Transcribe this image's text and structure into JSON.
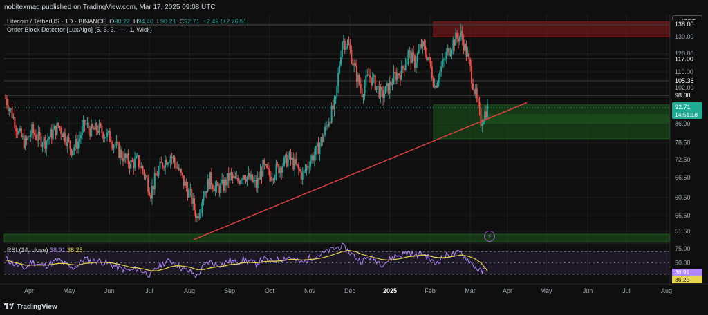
{
  "header": {
    "published": "nobitexmag published on TradingView.com, Mar 17, 2025 09:08 UTC",
    "symbol": "Litecoin / TetherUS · 1D · BINANCE",
    "ohlc": {
      "o_label": "O",
      "o": "90.22",
      "h_label": "H",
      "h": "94.40",
      "l_label": "L",
      "l": "90.21",
      "c_label": "C",
      "c": "92.71",
      "change": "+2.49 (+2.76%)"
    },
    "indicator": "Order Block Detector [LuxAlgo] (5, 3, 3, ──, 1, Wick)",
    "currency": "USDT"
  },
  "chart_data": {
    "type": "candlestick",
    "title": "Litecoin / TetherUS · 1D · BINANCE",
    "x_ticks": [
      "Apr",
      "May",
      "Jun",
      "Jul",
      "Aug",
      "Sep",
      "Oct",
      "Nov",
      "Dec",
      "2025",
      "Feb",
      "Mar",
      "Apr",
      "May",
      "Jun",
      "Jul",
      "Aug"
    ],
    "y_ticks": [
      "138.00",
      "130.00",
      "120.00",
      "117.00",
      "110.00",
      "105.38",
      "102.00",
      "98.30",
      "86.00",
      "78.50",
      "72.50",
      "66.50",
      "60.50",
      "55.50",
      "51.50"
    ],
    "price_axis_scale": "log",
    "last_price": "92.71",
    "countdown": "14:51:18",
    "ylim": [
      49,
      145
    ],
    "closes_weekly": [
      97,
      90,
      82,
      78,
      83,
      80,
      79,
      82,
      85,
      81,
      76,
      79,
      86,
      83,
      84,
      82,
      80,
      76,
      73,
      71,
      72,
      68,
      62,
      68,
      72,
      74,
      70,
      65,
      61,
      55,
      62,
      66,
      63,
      64,
      67,
      65,
      68,
      66,
      64,
      70,
      67,
      69,
      71,
      73,
      70,
      67,
      72,
      75,
      80,
      88,
      95,
      128,
      124,
      110,
      100,
      108,
      104,
      98,
      102,
      108,
      110,
      120,
      115,
      125,
      118,
      103,
      112,
      121,
      128,
      131,
      118,
      101,
      87,
      92.71
    ],
    "horizontal_levels": [
      117.0,
      105.38,
      98.3,
      137.5
    ],
    "order_blocks": [
      {
        "type": "bearish",
        "from": "Feb",
        "top": 139.5,
        "bottom": 130.0,
        "color": "#8a1a1a"
      },
      {
        "type": "bullish",
        "from": "Feb",
        "top": 94.0,
        "bottom": 80.0,
        "color": "#1e5a1e"
      },
      {
        "type": "bullish",
        "from": "Apr",
        "top": 50.8,
        "bottom": 49.0,
        "color": "#1e5a1e"
      }
    ],
    "trendline": {
      "from_date": "Aug",
      "from_price": 49.5,
      "to_date": "Mar",
      "to_price": 95.0,
      "color": "#e04040"
    },
    "rsi": {
      "label": "RSI (14, close)",
      "value": "38.91",
      "ma_value": "36.25",
      "levels": [
        "75.00",
        "50.00"
      ],
      "band": [
        70,
        30
      ],
      "ylim": [
        20,
        85
      ],
      "values_weekly": [
        58,
        50,
        44,
        40,
        52,
        47,
        45,
        50,
        55,
        48,
        40,
        46,
        58,
        52,
        54,
        50,
        47,
        41,
        38,
        36,
        40,
        34,
        28,
        42,
        50,
        54,
        46,
        38,
        34,
        26,
        44,
        52,
        46,
        48,
        54,
        50,
        56,
        52,
        48,
        58,
        52,
        55,
        58,
        60,
        54,
        50,
        58,
        62,
        66,
        72,
        76,
        80,
        70,
        60,
        52,
        60,
        56,
        48,
        54,
        62,
        64,
        70,
        62,
        68,
        60,
        48,
        58,
        64,
        66,
        68,
        56,
        44,
        34,
        38.91
      ],
      "ma_weekly": [
        55,
        52,
        49,
        46,
        46,
        46,
        46,
        47,
        49,
        49,
        47,
        46,
        49,
        50,
        51,
        51,
        50,
        48,
        45,
        42,
        41,
        39,
        36,
        36,
        39,
        43,
        45,
        44,
        42,
        38,
        38,
        41,
        43,
        44,
        47,
        48,
        50,
        51,
        50,
        52,
        53,
        53,
        54,
        56,
        56,
        55,
        56,
        57,
        59,
        62,
        66,
        70,
        72,
        70,
        65,
        62,
        59,
        56,
        55,
        56,
        58,
        61,
        62,
        64,
        63,
        60,
        59,
        60,
        62,
        64,
        62,
        58,
        50,
        36.25
      ],
      "rsi_color": "#b388ff",
      "ma_color": "#e6d64a"
    },
    "colors": {
      "up": "#26a69a",
      "down": "#ef5350",
      "bg": "#0f0f0f",
      "grid": "#1e1e1e",
      "level": "#d1d4dc",
      "last_price": "#22ab94"
    }
  },
  "footer": {
    "brand": "TradingView"
  }
}
